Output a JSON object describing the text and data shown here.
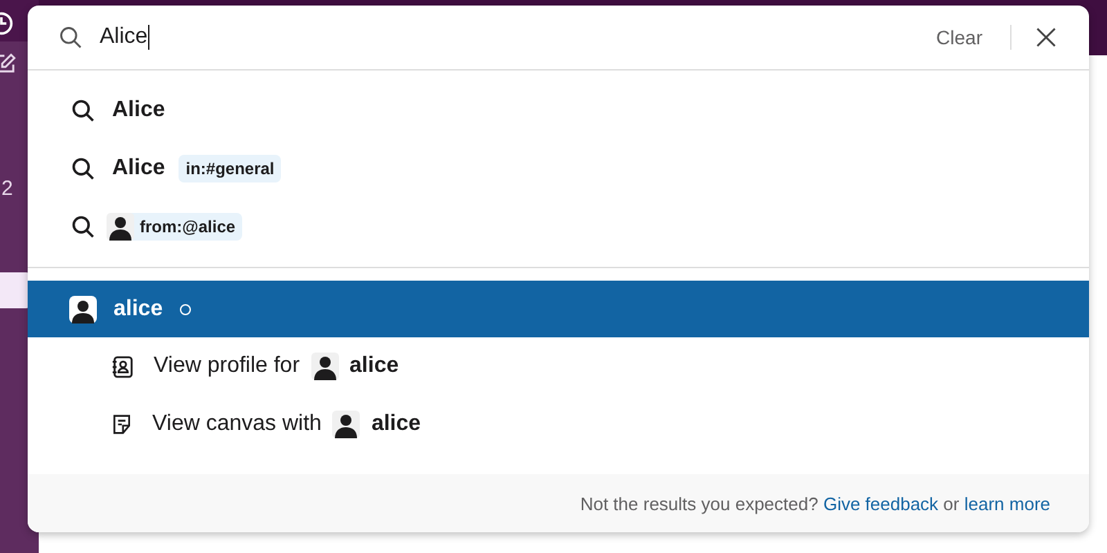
{
  "sidebar": {
    "count": "2"
  },
  "search": {
    "value": "Alice",
    "clear": "Clear"
  },
  "suggestions": [
    {
      "kind": "query",
      "text": "Alice"
    },
    {
      "kind": "query",
      "text": "Alice",
      "modifier": "in:#general"
    },
    {
      "kind": "from",
      "modifier": "from:@alice"
    }
  ],
  "people": [
    {
      "name": "alice",
      "selected": true,
      "online": false
    }
  ],
  "actions": [
    {
      "kind": "profile",
      "label": "View profile for",
      "name": "alice"
    },
    {
      "kind": "canvas",
      "label": "View canvas with",
      "name": "alice"
    }
  ],
  "footer": {
    "text": "Not the results you expected?",
    "feedback_link": "Give feedback",
    "joiner": "or",
    "learn_link": "learn more"
  }
}
